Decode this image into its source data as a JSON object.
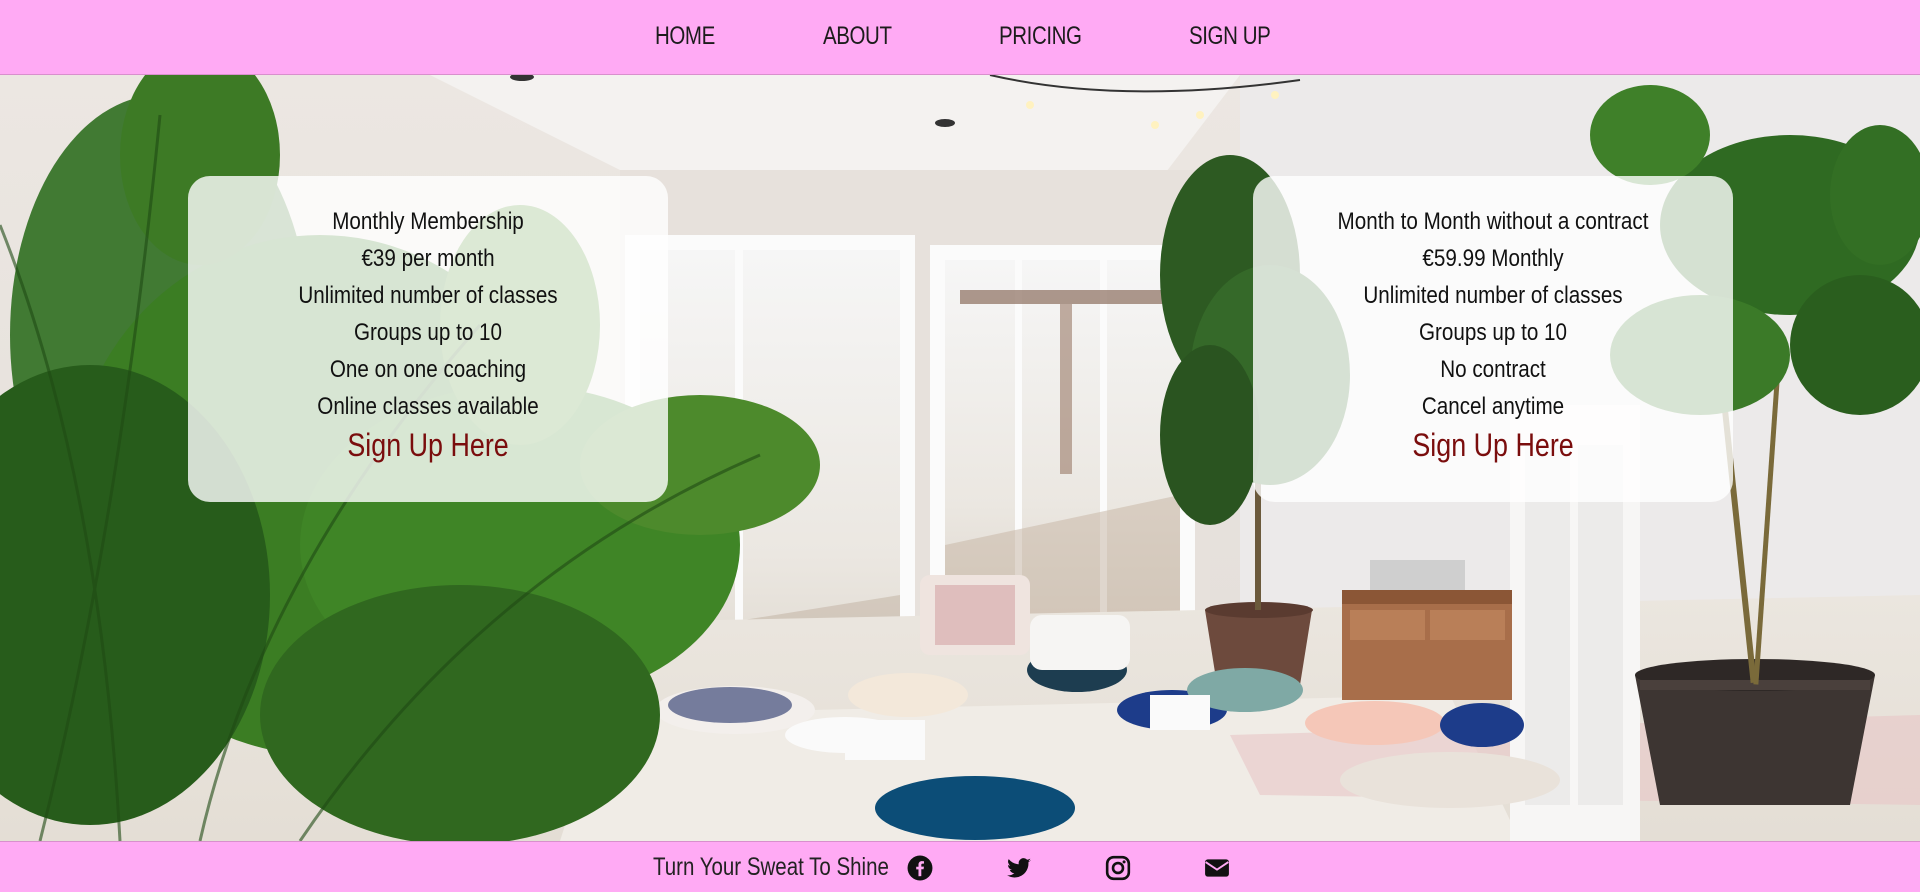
{
  "nav": {
    "items": [
      "HOME",
      "ABOUT",
      "PRICING",
      "SIGN UP"
    ]
  },
  "cards": [
    {
      "lines": [
        "Monthly Membership",
        "€39 per month",
        "Unlimited number of classes",
        "Groups up to 10",
        "One on one coaching",
        "Online classes available"
      ],
      "cta": "Sign Up Here"
    },
    {
      "lines": [
        "Month to Month without a contract",
        "€59.99 Monthly",
        "Unlimited number of classes",
        "Groups up to 10",
        "No contract",
        "Cancel anytime"
      ],
      "cta": "Sign Up Here"
    }
  ],
  "footer": {
    "tagline": "Turn Your Sweat To Shine",
    "social": [
      "facebook-icon",
      "twitter-icon",
      "instagram-icon",
      "envelope-icon"
    ]
  },
  "colors": {
    "nav_bg": "#ffaaf4",
    "cta": "#7a0d0d"
  }
}
